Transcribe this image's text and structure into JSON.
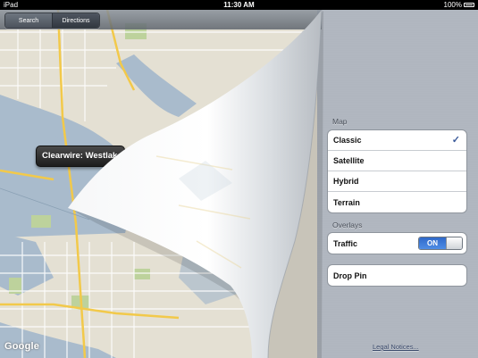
{
  "status_bar": {
    "device": "iPad",
    "time": "11:30 AM",
    "battery": "100%"
  },
  "toolbar": {
    "search_label": "Search",
    "directions_label": "Directions"
  },
  "map": {
    "callout_text": "Clearwire: Westlak",
    "attribution": "Google",
    "colors": {
      "water": "#a9bbcc",
      "land": "#e4e0d3",
      "park": "#bdd29c",
      "highway": "#f2c94a",
      "road": "#ffffff"
    }
  },
  "settings": {
    "map_section_title": "Map",
    "map_types": [
      {
        "label": "Classic",
        "selected": true
      },
      {
        "label": "Satellite",
        "selected": false
      },
      {
        "label": "Hybrid",
        "selected": false
      },
      {
        "label": "Terrain",
        "selected": false
      }
    ],
    "overlays_section_title": "Overlays",
    "traffic_label": "Traffic",
    "traffic_toggle": "ON",
    "drop_pin_label": "Drop Pin",
    "legal_link": "Legal Notices..."
  },
  "colors": {
    "accent": "#3a6fd0",
    "linen": "#b2b8c1",
    "status_bar": "#000000"
  }
}
